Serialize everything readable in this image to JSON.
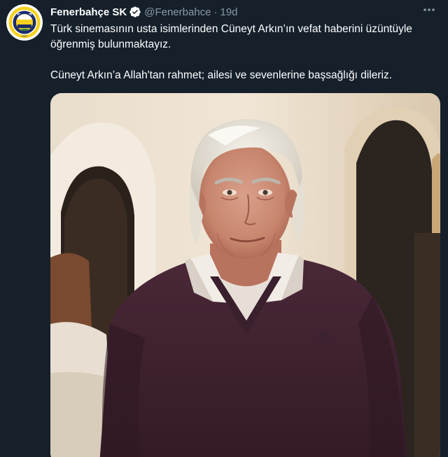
{
  "tweet": {
    "display_name": "Fenerbahçe SK",
    "handle": "@Fenerbahce",
    "separator": "·",
    "time": "19d",
    "paragraphs": [
      "Türk sinemasının usta isimlerinden Cüneyt Arkın’ın vefat haberini üzüntüyle öğrenmiş bulunmaktayız.",
      "Cüneyt Arkın’a Allah'tan rahmet; ailesi ve sevenlerine başsağlığı dileriz."
    ]
  },
  "avatar": {
    "logo_text": "FENERBAHÇE SPOR KULÜBÜ",
    "year": "1907"
  },
  "colors": {
    "background": "#15202b",
    "secondary_text": "#8b98a5",
    "verified": "#1d9bf0",
    "logo_yellow": "#f6d21e",
    "logo_navy": "#1c2c6b"
  },
  "icons": {
    "verified": "verified-badge-icon",
    "more": "more-options-icon"
  }
}
